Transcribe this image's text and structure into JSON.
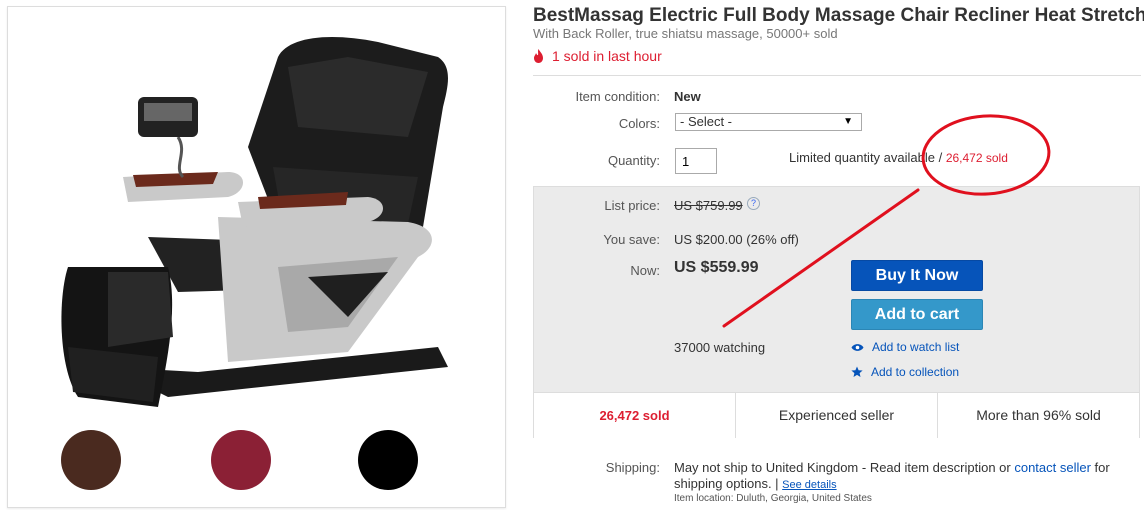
{
  "product": {
    "title": "BestMassag Electric Full Body Massage Chair Recliner Heat Stretched F",
    "subtitle": "With Back Roller, true shiatsu massage, 50000+ sold",
    "hot_text": "1 sold in last hour"
  },
  "gallery": {
    "swatches": [
      {
        "name": "brown",
        "color": "#4a2a1f"
      },
      {
        "name": "burgundy",
        "color": "#8b2035"
      },
      {
        "name": "black",
        "color": "#000000"
      }
    ]
  },
  "details": {
    "condition_label": "Item condition:",
    "condition_value": "New",
    "colors_label": "Colors:",
    "colors_selected": "- Select -",
    "quantity_label": "Quantity:",
    "quantity_value": "1",
    "availability_text": "Limited quantity available / ",
    "availability_sold": "26,472 sold"
  },
  "pricing": {
    "list_price_label": "List price:",
    "list_price_value": "US $759.99",
    "you_save_label": "You save:",
    "you_save_value": "US $200.00 (26% off)",
    "now_label": "Now:",
    "now_value": "US $559.99",
    "buy_now": "Buy It Now",
    "add_to_cart": "Add to cart",
    "watching": "37000 watching",
    "add_watch": "Add to watch list",
    "add_collection": "Add to collection"
  },
  "stats": {
    "sold": "26,472 sold",
    "seller": "Experienced seller",
    "percent": "More than 96% sold"
  },
  "shipping": {
    "label": "Shipping:",
    "text_before": "May not ship to United Kingdom - Read item description or ",
    "contact_link": "contact seller",
    "text_after": " for shipping options. | ",
    "see_details": "See details",
    "location": "Item location:  Duluth, Georgia, United States"
  },
  "colors": {
    "accent_red": "#dd1e31",
    "buy_blue": "#0654ba",
    "cart_blue": "#3498ca",
    "annotation_red": "#e0101e"
  }
}
